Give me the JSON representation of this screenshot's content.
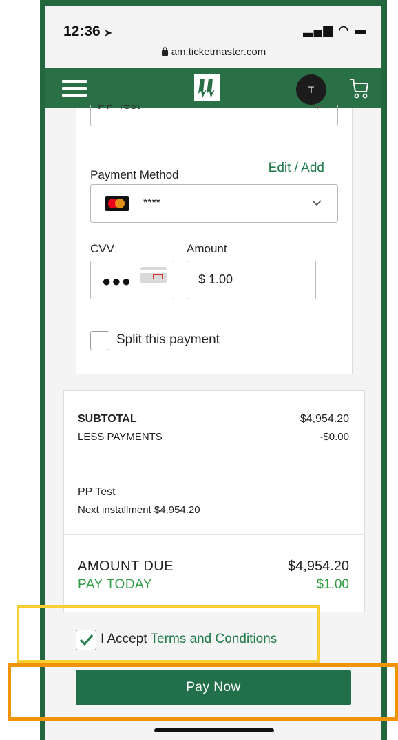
{
  "status_bar": {
    "time": "12:36",
    "location_arrow": "➤",
    "indicators": "▂▄▆ ◠ ▬"
  },
  "browser": {
    "url": "am.ticketmaster.com",
    "lock_icon": "lock-icon"
  },
  "header": {
    "menu_icon": "hamburger-icon",
    "avatar_initial": "T",
    "cart_icon": "cart-icon"
  },
  "payment": {
    "previous_select_value": "PP Test",
    "method_label": "Payment Method",
    "edit_link": "Edit / Add",
    "card_masked": "****",
    "cvv_label": "CVV",
    "cvv_value": "●●●",
    "amount_label": "Amount",
    "amount_value": "$ 1.00",
    "split_label": "Split this payment"
  },
  "summary": {
    "subtotal_label": "SUBTOTAL",
    "subtotal_value": "$4,954.20",
    "less_payments_label": "LESS PAYMENTS",
    "less_payments_value": "-$0.00",
    "plan_name": "PP Test",
    "next_installment": "Next installment $4,954.20",
    "amount_due_label": "AMOUNT DUE",
    "amount_due_value": "$4,954.20",
    "pay_today_label": "PAY TODAY",
    "pay_today_value": "$1.00"
  },
  "terms": {
    "accept_text": "I Accept",
    "link_text": "Terms and Conditions",
    "checked": true
  },
  "actions": {
    "pay_now": "Pay Now"
  },
  "colors": {
    "brand_green": "#2a7046",
    "link_green": "#1f7a4a",
    "pay_today_green": "#2f9e44",
    "highlight_yellow": "#f9cf34",
    "highlight_orange": "#f09300"
  }
}
